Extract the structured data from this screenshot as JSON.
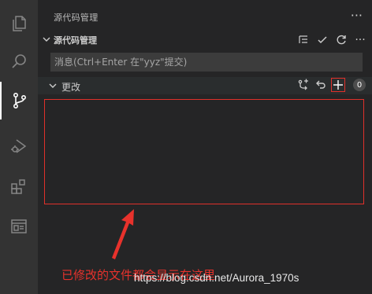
{
  "panel": {
    "title": "源代码管理",
    "more": "···"
  },
  "source_control": {
    "section_title": "源代码管理",
    "actions": [
      "list-tree-icon",
      "check-icon",
      "refresh-icon",
      "more-icon"
    ],
    "more": "···"
  },
  "commit": {
    "placeholder": "消息(Ctrl+Enter 在\"yyz\"提交)"
  },
  "changes": {
    "title": "更改",
    "count": "0",
    "actions": [
      "open-changes-icon",
      "discard-icon",
      "stage-all-icon"
    ]
  },
  "annotation": {
    "text": "已修改的文件都会显示在这里",
    "color": "#e8322c"
  },
  "watermark": {
    "text": "https://blog.csdn.net/Aurora_1970s"
  },
  "colors": {
    "activity_bar": "#333333",
    "sidebar": "#252526",
    "input_bg": "#3c3c3c",
    "highlight": "#e0302a"
  },
  "activity_bar": {
    "items": [
      "explorer-icon",
      "search-icon",
      "source-control-icon",
      "run-debug-icon",
      "extensions-icon",
      "remote-explorer-icon"
    ]
  }
}
